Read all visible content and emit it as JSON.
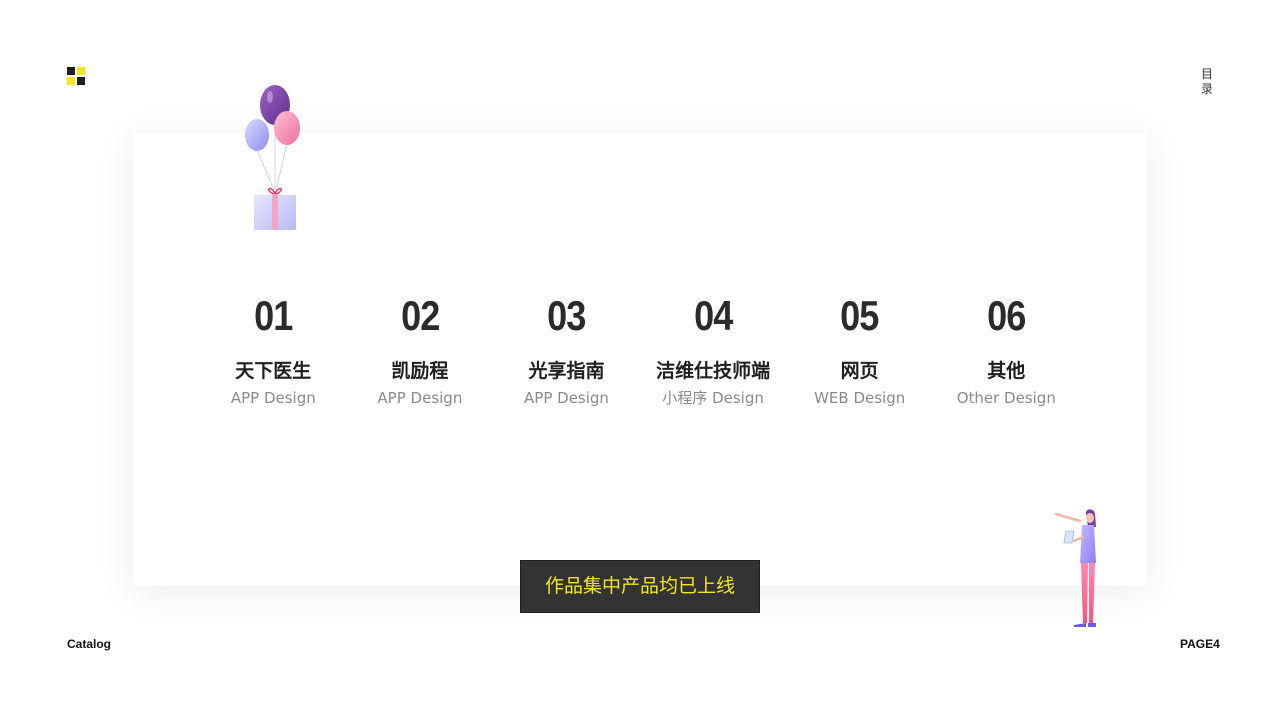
{
  "header": {
    "side_label_line1": "目",
    "side_label_line2": "录"
  },
  "catalog_items": [
    {
      "number": "01",
      "title": "天下医生",
      "subtitle": "APP Design"
    },
    {
      "number": "02",
      "title": "凯励程",
      "subtitle": "APP Design"
    },
    {
      "number": "03",
      "title": "光享指南",
      "subtitle": "APP Design"
    },
    {
      "number": "04",
      "title": "洁维仕技师端",
      "subtitle": "小程序 Design"
    },
    {
      "number": "05",
      "title": "网页",
      "subtitle": "WEB Design"
    },
    {
      "number": "06",
      "title": "其他",
      "subtitle": "Other Design"
    }
  ],
  "notice": {
    "text": "作品集中产品均已上线"
  },
  "footer": {
    "left": "Catalog",
    "right": "PAGE4"
  },
  "colors": {
    "accent_yellow": "#f5e51f",
    "dark": "#333333",
    "balloon_purple": "#7d4aa6",
    "balloon_pink": "#f27ba6",
    "balloon_lavender": "#a6a6f2"
  },
  "icons": {
    "logo": "four-square-logo-icon",
    "balloons": "balloons-gift-illustration",
    "person": "person-with-tablet-illustration"
  }
}
